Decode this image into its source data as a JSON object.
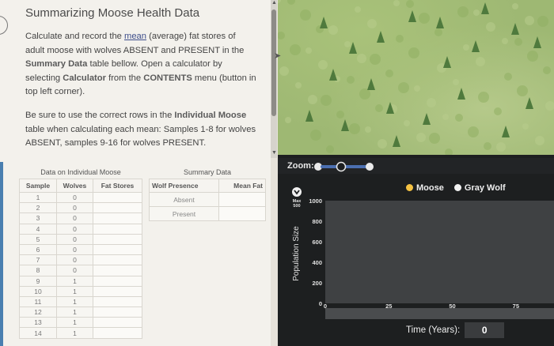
{
  "instructions": {
    "title": "Summarizing Moose Health Data",
    "para1": {
      "t1": "Calculate and record the ",
      "link_mean": "mean",
      "t2": " (average) fat stores of adult moose with wolves ABSENT and PRESENT in the ",
      "b_summary": "Summary Data",
      "t3": " table bellow. Open a calculator by selecting ",
      "b_calc": "Calculator",
      "t4": " from the ",
      "b_contents": "CONTENTS",
      "t5": " menu (button in top left corner)."
    },
    "para2": {
      "t1": "Be sure to use the correct rows in the ",
      "b_individual": "Individual Moose",
      "t2": " table when calculating each mean: Samples 1-8 for wolves ABSENT, samples 9-16 for wolves PRESENT."
    }
  },
  "individual_table": {
    "caption": "Data on Individual Moose",
    "headers": [
      "Sample",
      "Wolves",
      "Fat Stores"
    ],
    "rows": [
      [
        "1",
        "0",
        ""
      ],
      [
        "2",
        "0",
        ""
      ],
      [
        "3",
        "0",
        ""
      ],
      [
        "4",
        "0",
        ""
      ],
      [
        "5",
        "0",
        ""
      ],
      [
        "6",
        "0",
        ""
      ],
      [
        "7",
        "0",
        ""
      ],
      [
        "8",
        "0",
        ""
      ],
      [
        "9",
        "1",
        ""
      ],
      [
        "10",
        "1",
        ""
      ],
      [
        "11",
        "1",
        ""
      ],
      [
        "12",
        "1",
        ""
      ],
      [
        "13",
        "1",
        ""
      ],
      [
        "14",
        "1",
        ""
      ]
    ]
  },
  "summary_table": {
    "caption": "Summary Data",
    "headers": [
      "Wolf Presence",
      "Mean Fat"
    ],
    "rows": [
      [
        "Absent",
        ""
      ],
      [
        "Present",
        ""
      ]
    ]
  },
  "simulation": {
    "zoom_label": "Zoom:",
    "max_label": "Max\n500",
    "legend": [
      {
        "name": "Moose",
        "color": "#f5c242"
      },
      {
        "name": "Gray Wolf",
        "color": "#f2f2f2"
      }
    ],
    "time_label": "Time (Years):",
    "time_value": "0"
  },
  "chart_data": {
    "type": "line",
    "title": "",
    "xlabel": "Time (Years)",
    "ylabel": "Population Size",
    "x_ticks": [
      "0",
      "25",
      "50",
      "75"
    ],
    "y_ticks": [
      "0",
      "200",
      "400",
      "600",
      "800",
      "1000"
    ],
    "xlim": [
      0,
      90
    ],
    "ylim": [
      0,
      1000
    ],
    "series": [
      {
        "name": "Moose",
        "color": "#f5c242",
        "x": [],
        "y": []
      },
      {
        "name": "Gray Wolf",
        "color": "#f2f2f2",
        "x": [],
        "y": []
      }
    ]
  }
}
